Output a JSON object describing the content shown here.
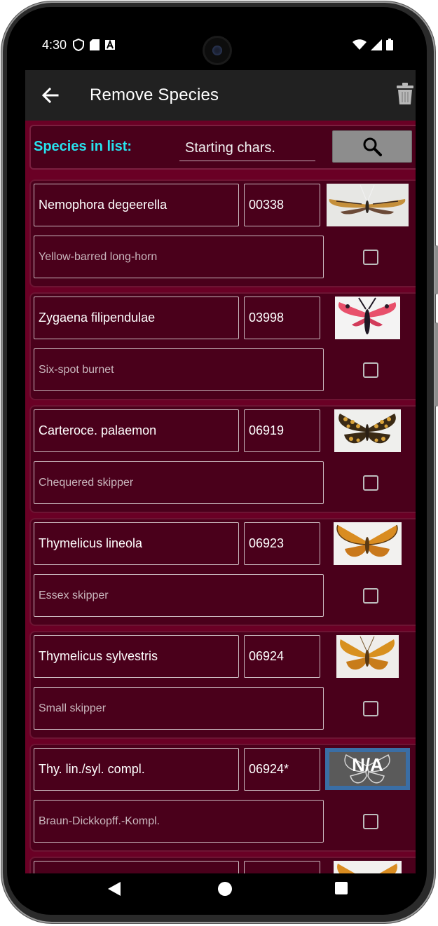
{
  "status": {
    "time": "4:30"
  },
  "appbar": {
    "title": "Remove Species"
  },
  "search": {
    "label": "Species in list:",
    "placeholder": "Starting chars."
  },
  "species": [
    {
      "scientific": "Nemophora degeerella",
      "code": "00338",
      "common": "Yellow-barred long-horn",
      "image": "moth-longhorn"
    },
    {
      "scientific": "Zygaena filipendulae",
      "code": "03998",
      "common": "Six-spot burnet",
      "image": "burnet-moth"
    },
    {
      "scientific": "Carteroce. palaemon",
      "code": "06919",
      "common": "Chequered skipper",
      "image": "chequered-skipper"
    },
    {
      "scientific": "Thymelicus lineola",
      "code": "06923",
      "common": "Essex skipper",
      "image": "orange-skipper"
    },
    {
      "scientific": "Thymelicus sylvestris",
      "code": "06924",
      "common": "Small skipper",
      "image": "orange-skipper"
    },
    {
      "scientific": "Thy. lin./syl. compl.",
      "code": "06924*",
      "common": "Braun-Dickkopff.-Kompl.",
      "image": "not-available"
    }
  ],
  "na_label": "N/A",
  "colors": {
    "background": "#6a0025",
    "card": "#4a001b",
    "label_accent": "#27e2ee",
    "appbar": "#212121"
  }
}
